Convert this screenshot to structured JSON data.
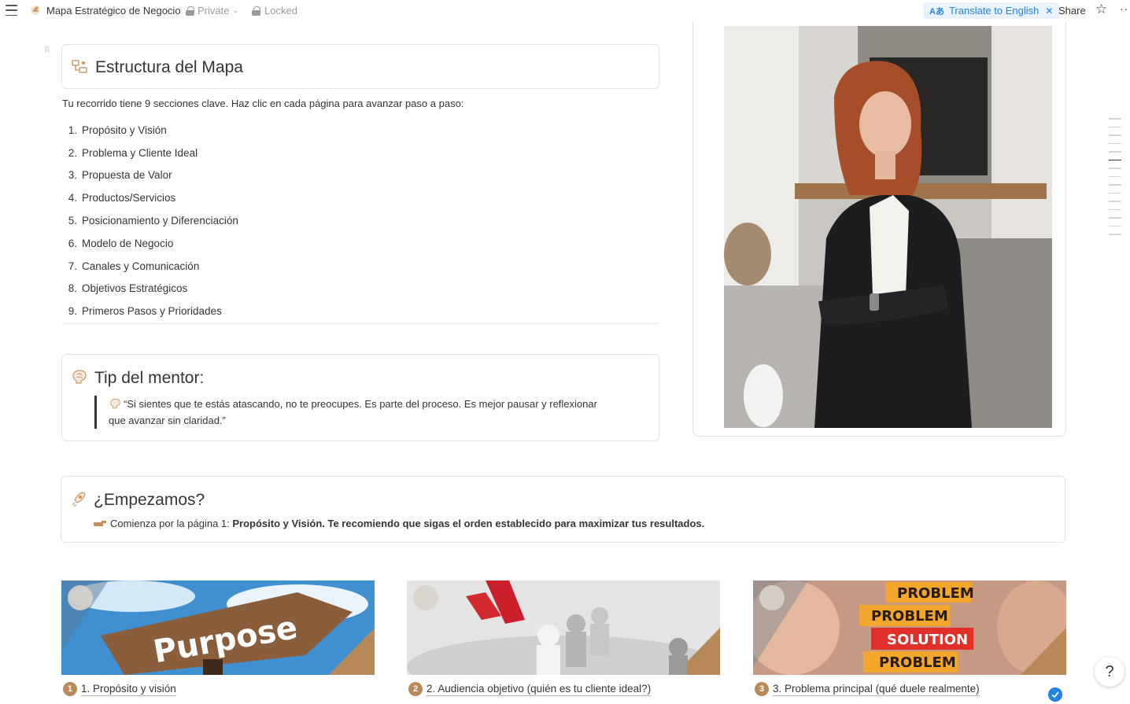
{
  "topbar": {
    "page_title": "Mapa Estratégico de Negocio",
    "privacy": "Private",
    "locked": "Locked",
    "translate": "Translate to English",
    "share": "Share"
  },
  "structure": {
    "title": "Estructura del Mapa",
    "intro": "Tu recorrido tiene 9 secciones clave. Haz clic en cada página para avanzar paso a paso:",
    "steps": [
      {
        "num": "1.",
        "label": "Propósito y Visión"
      },
      {
        "num": "2.",
        "label": "Problema y Cliente Ideal"
      },
      {
        "num": "3.",
        "label": "Propuesta de Valor"
      },
      {
        "num": "4.",
        "label": "Productos/Servicios"
      },
      {
        "num": "5.",
        "label": "Posicionamiento y Diferenciación"
      },
      {
        "num": "6.",
        "label": "Modelo de Negocio"
      },
      {
        "num": "7.",
        "label": "Canales y Comunicación"
      },
      {
        "num": "8.",
        "label": "Objetivos Estratégicos"
      },
      {
        "num": "9.",
        "label": "Primeros Pasos y Prioridades"
      }
    ]
  },
  "tip": {
    "title": "Tip del mentor:",
    "quote": "“Si sientes que te estás atascando, no te preocupes. Es parte del proceso. Es mejor pausar y reflexionar que avanzar sin claridad.”"
  },
  "start": {
    "title": "¿Empezamos?",
    "prefix": "Comienza por la página 1: ",
    "bold": "Propósito y Visión. Te recomiendo que sigas el orden establecido para maximizar tus resultados."
  },
  "cards": [
    {
      "badge": "1",
      "label": "1. Propósito y visión",
      "cover_word": "Purpose"
    },
    {
      "badge": "2",
      "label": "2. Audiencia objetivo (quién es tu cliente ideal?)"
    },
    {
      "badge": "3",
      "label": "3. Problema principal (qué duele realmente)",
      "cover_words": [
        "PROBLEM",
        "PROBLEM",
        "SOLUTION",
        "PROBLEM"
      ]
    }
  ],
  "colors": {
    "accent": "#2383e2",
    "badge": "#b88a5a",
    "text": "#37352f",
    "border": "#e3e2e0"
  },
  "icons": [
    "menu-icon",
    "page-icon",
    "lock-icon",
    "translate-icon",
    "star-icon",
    "more-icon",
    "map-icon",
    "brain-icon",
    "rocket-icon",
    "pointing-hand-icon",
    "check-icon",
    "help-icon"
  ]
}
